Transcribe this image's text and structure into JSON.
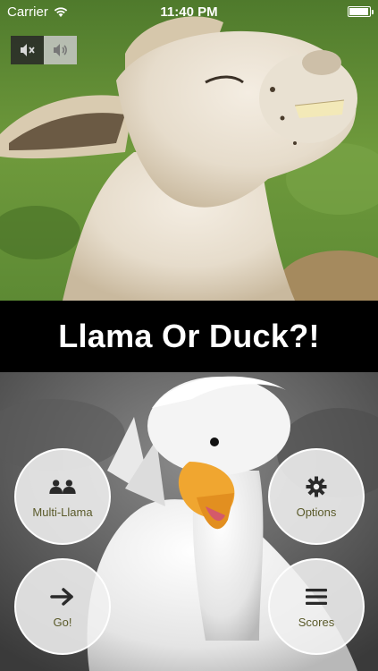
{
  "status_bar": {
    "carrier": "Carrier",
    "time": "11:40 PM",
    "battery_level": 0.95
  },
  "sound": {
    "mute_icon": "speaker-muted-icon",
    "unmute_icon": "speaker-on-icon"
  },
  "title": "Llama Or Duck?!",
  "menu": {
    "multi_llama_label": "Multi-Llama",
    "options_label": "Options",
    "go_label": "Go!",
    "scores_label": "Scores"
  },
  "colors": {
    "button_label": "#5a5a2a",
    "banner": "#000000"
  }
}
